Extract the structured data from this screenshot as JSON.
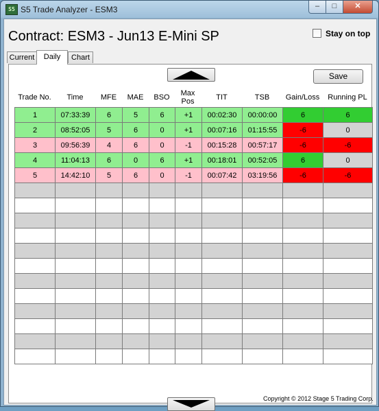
{
  "window": {
    "title": "S5 Trade Analyzer - ESM3",
    "icon_text": "S5",
    "minimize_icon": "minimize-icon",
    "maximize_icon": "maximize-icon",
    "close_icon": "close-icon",
    "minimize_glyph": "–",
    "maximize_glyph": "□",
    "close_glyph": "✕"
  },
  "header": {
    "contract_title": "Contract: ESM3 - Jun13 E-Mini SP",
    "stay_on_top_label": "Stay on top",
    "stay_on_top_checked": false
  },
  "tabs": [
    {
      "label": "Current",
      "active": false
    },
    {
      "label": "Daily",
      "active": true
    },
    {
      "label": "Chart",
      "active": false
    }
  ],
  "toolbar": {
    "save_label": "Save",
    "scroll_up_icon": "triangle-up-icon",
    "scroll_down_icon": "triangle-down-icon"
  },
  "colors": {
    "win_green": "#90ee90",
    "loss_pink": "#ffc0cb",
    "gain_green": "#32cd32",
    "loss_red": "#ff0000",
    "neutral_gray": "#d3d3d3",
    "empty_gray": "#d3d3d3",
    "empty_white": "#ffffff"
  },
  "table": {
    "columns": [
      "Trade No.",
      "Time",
      "MFE",
      "MAE",
      "BSO",
      "Max Pos",
      "TIT",
      "TSB",
      "Gain/Loss",
      "Running PL"
    ],
    "rows": [
      {
        "cells": [
          "1",
          "07:33:39",
          "6",
          "5",
          "6",
          "+1",
          "00:02:30",
          "00:00:00",
          "6",
          "6"
        ],
        "row_style": "win",
        "gl_style": "gain",
        "pl_style": "gain"
      },
      {
        "cells": [
          "2",
          "08:52:05",
          "5",
          "6",
          "0",
          "+1",
          "00:07:16",
          "01:15:55",
          "-6",
          "0"
        ],
        "row_style": "win",
        "gl_style": "loss",
        "pl_style": "neutral"
      },
      {
        "cells": [
          "3",
          "09:56:39",
          "4",
          "6",
          "0",
          "-1",
          "00:15:28",
          "00:57:17",
          "-6",
          "-6"
        ],
        "row_style": "loss",
        "gl_style": "loss",
        "pl_style": "loss"
      },
      {
        "cells": [
          "4",
          "11:04:13",
          "6",
          "0",
          "6",
          "+1",
          "00:18:01",
          "00:52:05",
          "6",
          "0"
        ],
        "row_style": "win",
        "gl_style": "gain",
        "pl_style": "neutral"
      },
      {
        "cells": [
          "5",
          "14:42:10",
          "5",
          "6",
          "0",
          "-1",
          "00:07:42",
          "03:19:56",
          "-6",
          "-6"
        ],
        "row_style": "loss",
        "gl_style": "loss",
        "pl_style": "loss"
      }
    ],
    "empty_rows": 12
  },
  "footer": {
    "copyright": "Copyright © 2012 Stage 5 Trading Corp."
  }
}
